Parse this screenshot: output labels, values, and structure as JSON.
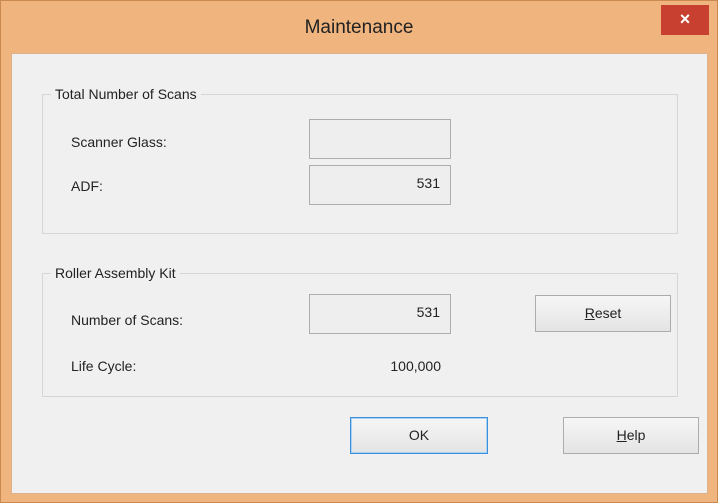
{
  "window": {
    "title": "Maintenance",
    "close_glyph": "×"
  },
  "total_scans": {
    "title": "Total Number of Scans",
    "scanner_glass_label": "Scanner Glass:",
    "scanner_glass_value": "",
    "adf_label": "ADF:",
    "adf_value": "531"
  },
  "roller_kit": {
    "title": "Roller Assembly Kit",
    "num_scans_label": "Number of Scans:",
    "num_scans_value": "531",
    "reset_mnemonic": "R",
    "reset_rest": "eset",
    "life_cycle_label": "Life Cycle:",
    "life_cycle_value": "100,000"
  },
  "buttons": {
    "ok_label": "OK",
    "help_mnemonic": "H",
    "help_rest": "elp"
  },
  "colors": {
    "title_bar": "#f0b47f",
    "close_button": "#c8402f",
    "dialog_background": "#f0f0f0",
    "default_button_border": "#3c8fd8"
  },
  "icons": {
    "close": "close-icon"
  }
}
